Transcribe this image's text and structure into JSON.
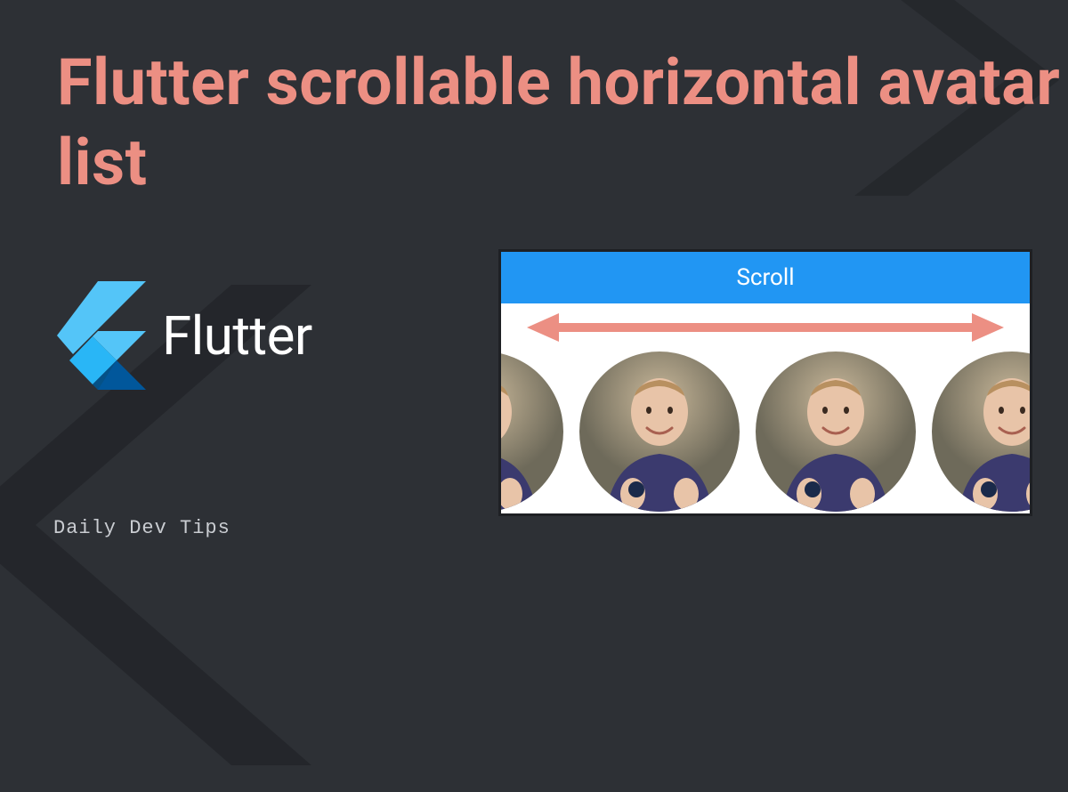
{
  "title": "Flutter scrollable horizontal avatar list",
  "flutter_label": "Flutter",
  "footer": "Daily Dev Tips",
  "preview": {
    "header": "Scroll",
    "avatar_count": 4
  },
  "colors": {
    "accent": "#ec8f83",
    "bg": "#2d3035",
    "flutter_blue_light": "#54c5f8",
    "flutter_blue_dark": "#01579b",
    "preview_header": "#2196f3"
  }
}
